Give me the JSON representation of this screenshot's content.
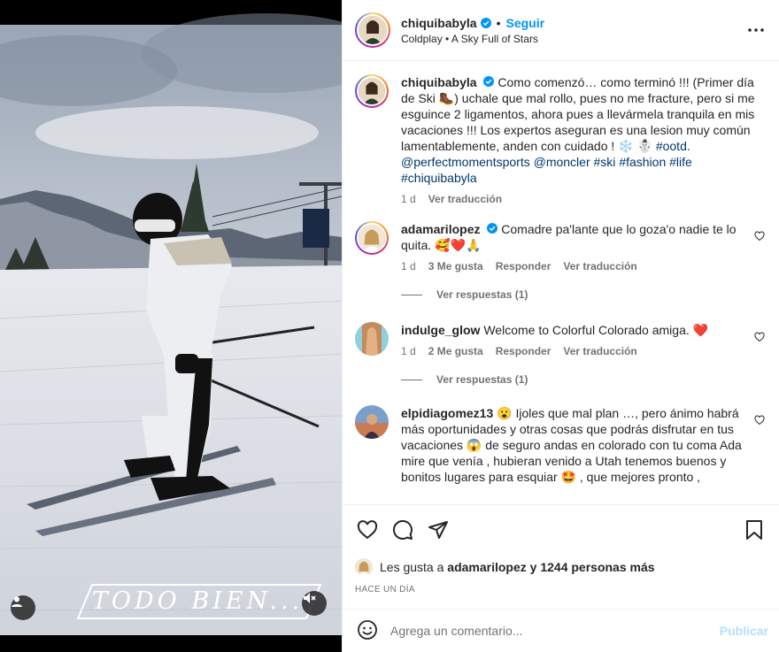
{
  "post": {
    "author": "chiquibabyla",
    "follow_label": "Seguir",
    "separator": "•",
    "audio": "Coldplay • A Sky Full of Stars",
    "more_icon": "more-options-icon"
  },
  "media": {
    "overlay_text": "TODO BIEN..."
  },
  "caption": {
    "username": "chiquibabyla",
    "text_a": "Como comenzó… como terminó !!! (Primer día de Ski ",
    "text_b": ") uchale que mal rollo, pues no me fracture, pero si me esguince 2 ligamentos, ahora pues a llevármela tranquila en mis vacaciones !!! Los expertos aseguran es una lesion muy común lamentablemente, anden con cuidado ! ❄️ ☃️ ",
    "tag_ootd": "#ootd",
    "text_c": ".",
    "mention_1": "@perfectmomentsports",
    "mention_2": "@moncler",
    "tag_ski": "#ski",
    "tag_fashion": "#fashion",
    "tag_life": "#life",
    "tag_chiqui": "#chiquibabyla",
    "time": "1 d",
    "translate": "Ver traducción"
  },
  "comments": [
    {
      "username": "adamarilopez",
      "text": "Comadre pa'lante que lo goza'o nadie te lo quita. 🥰❤️🙏",
      "time": "1 d",
      "likes": "3 Me gusta",
      "reply": "Responder",
      "translate": "Ver traducción",
      "view_replies": "Ver respuestas (1)"
    },
    {
      "username": "indulge_glow",
      "text": "Welcome to Colorful Colorado amiga. ❤️",
      "time": "1 d",
      "likes": "2 Me gusta",
      "reply": "Responder",
      "translate": "Ver traducción",
      "view_replies": "Ver respuestas (1)"
    },
    {
      "username": "elpidiagomez13",
      "text": "😮 Ijoles que mal plan …, pero ánimo habrá más oportunidades y otras cosas que podrás disfrutar en tus vacaciones 😱 de seguro andas en colorado con tu coma Ada mire que venía , hubieran venido a Utah tenemos buenos y bonitos lugares para esquiar 🤩 , que mejores pronto ,"
    }
  ],
  "likes": {
    "prefix": "Les gusta a ",
    "user": "adamarilopez",
    "suffix": " y 1244 personas más"
  },
  "date": "HACE UN DÍA",
  "composer": {
    "placeholder": "Agrega un comentario...",
    "post_label": "Publicar"
  },
  "colors": {
    "accent": "#0095f6",
    "verified": "#0095f6",
    "link": "#00376b",
    "muted": "#737373",
    "like_red": "#ed4956"
  }
}
